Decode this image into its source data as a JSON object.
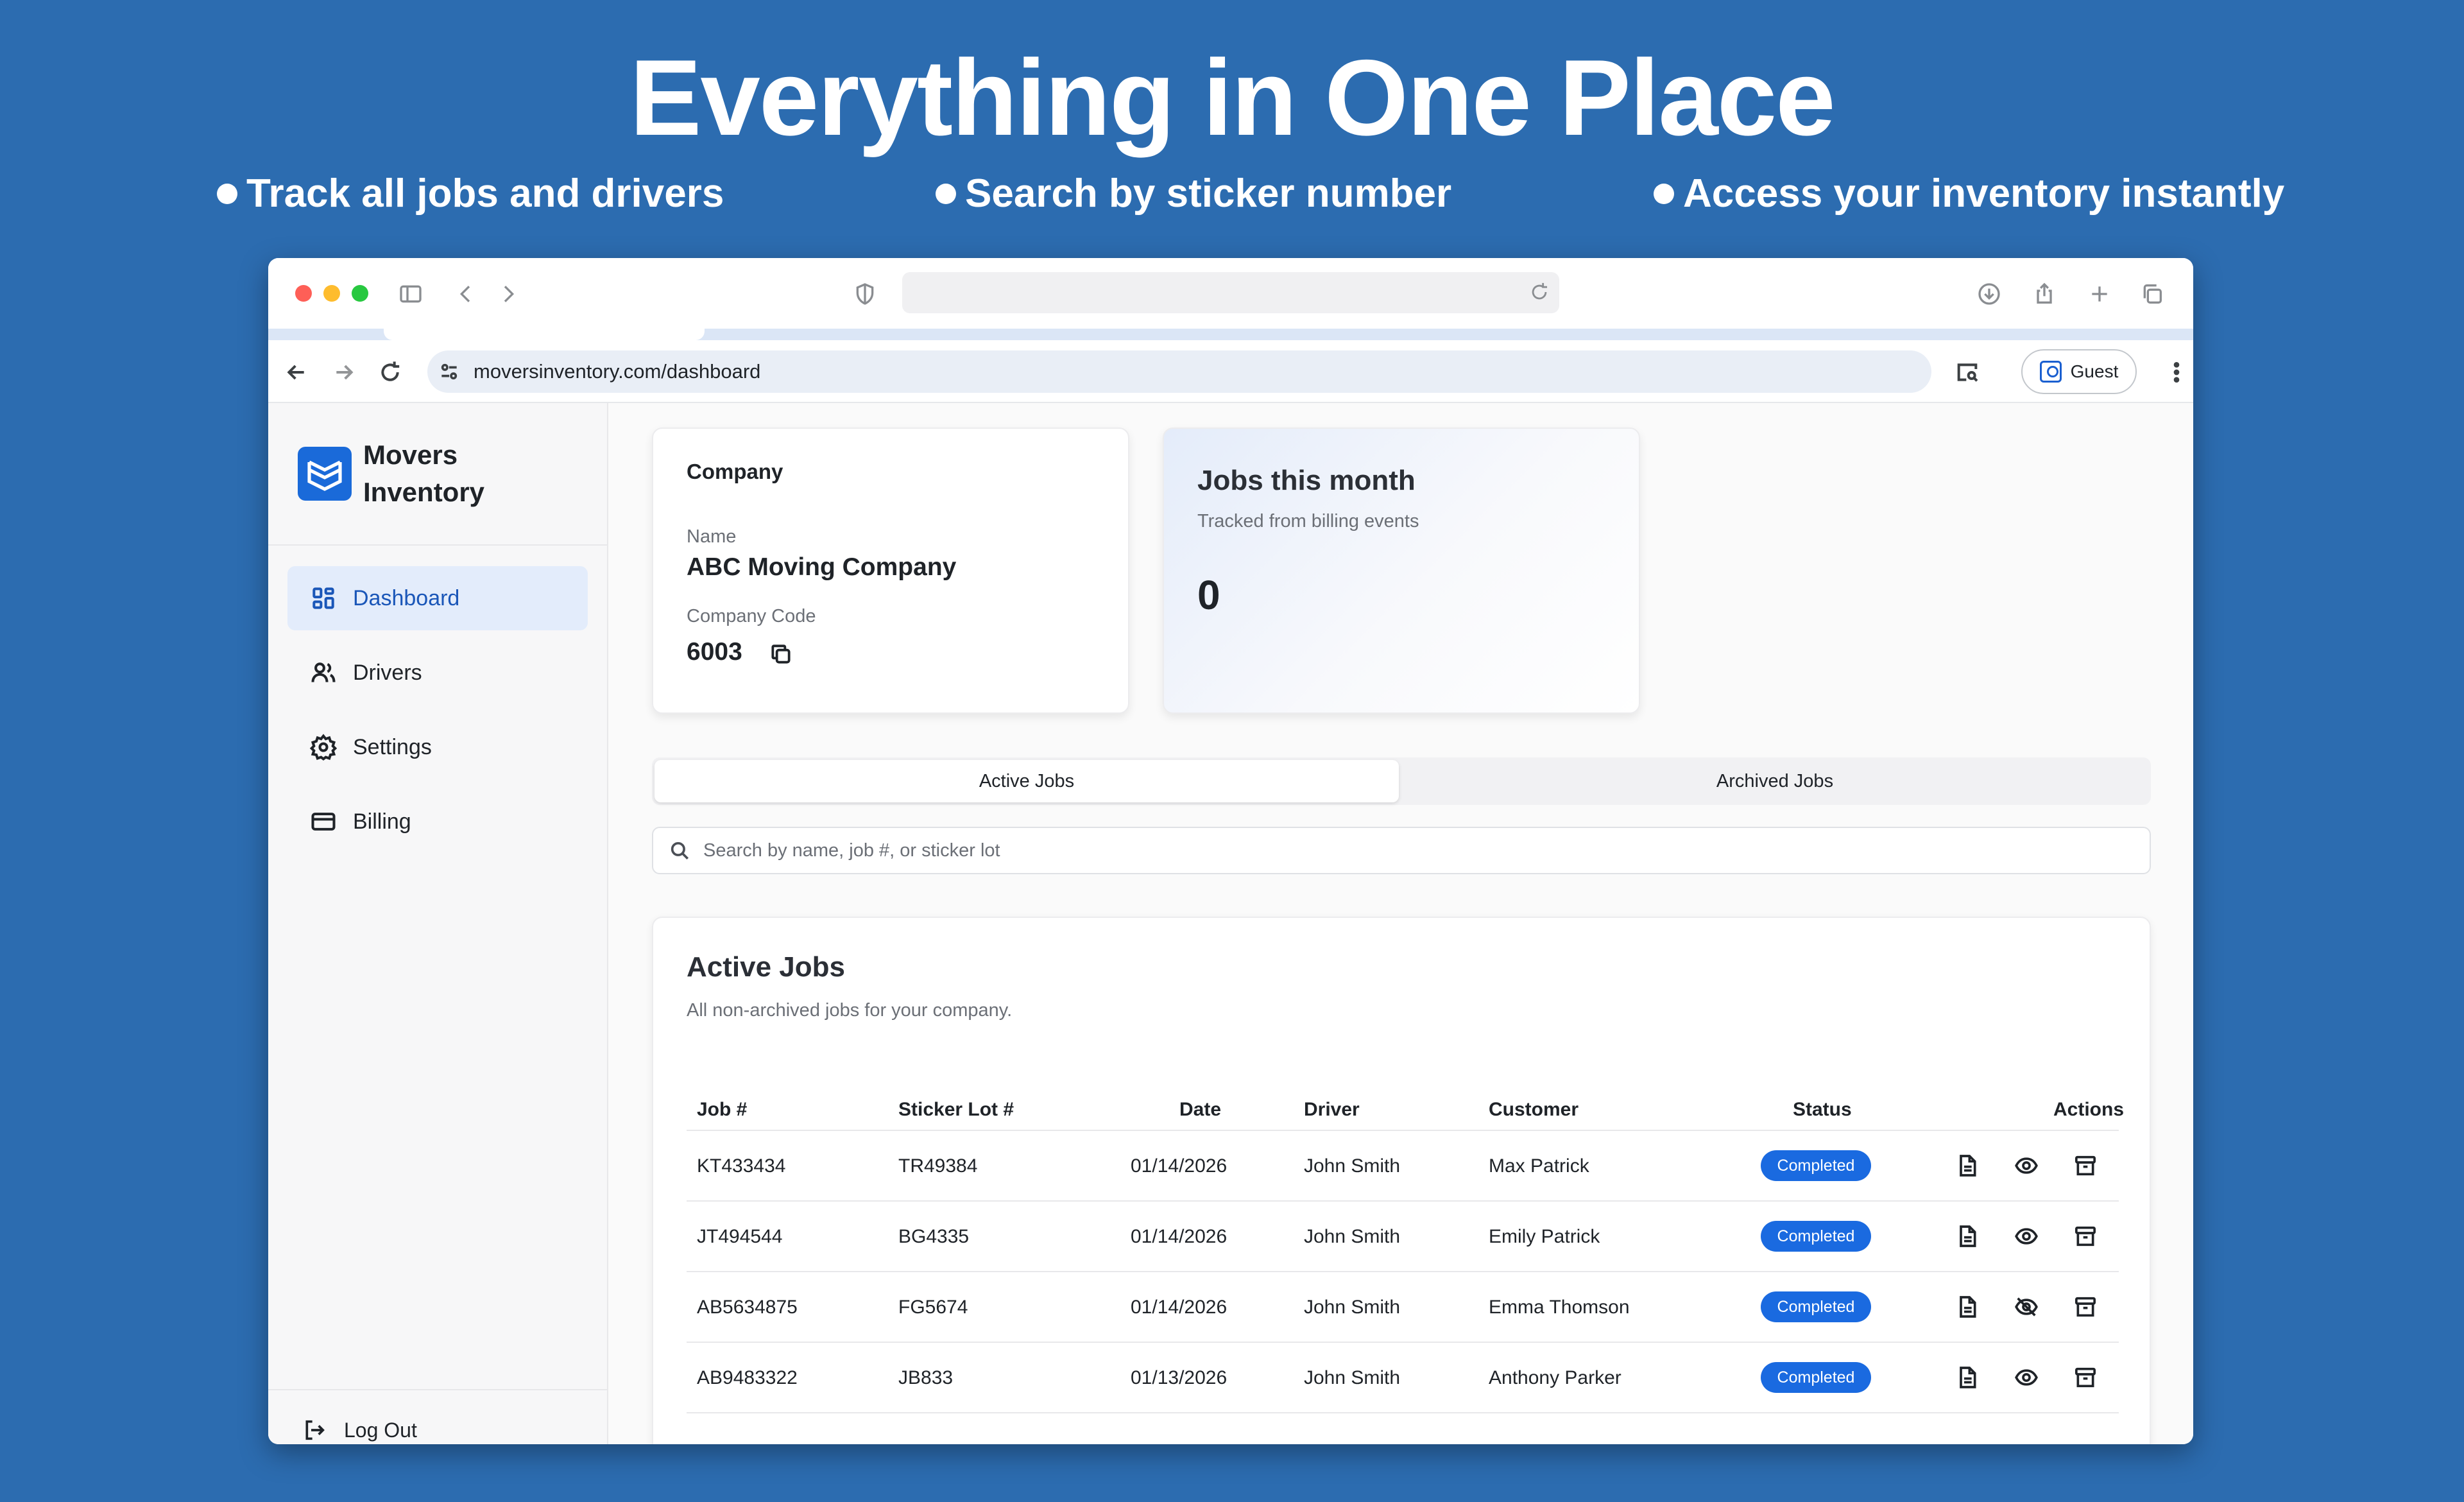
{
  "hero": {
    "title": "Everything in One Place",
    "bullets": [
      "Track all jobs and drivers",
      "Search by sticker number",
      "Access your inventory instantly"
    ]
  },
  "browser": {
    "url": "moversinventory.com/dashboard",
    "profile_label": "Guest"
  },
  "brand": {
    "line1": "Movers",
    "line2": "Inventory",
    "color": "#1a6ad9"
  },
  "sidebar": {
    "items": [
      {
        "label": "Dashboard",
        "icon": "dashboard-grid-icon",
        "active": true
      },
      {
        "label": "Drivers",
        "icon": "users-icon",
        "active": false
      },
      {
        "label": "Settings",
        "icon": "gear-icon",
        "active": false
      },
      {
        "label": "Billing",
        "icon": "credit-card-icon",
        "active": false
      }
    ],
    "logout_label": "Log Out"
  },
  "company": {
    "title": "Company",
    "name_label": "Name",
    "name": "ABC Moving Company",
    "code_label": "Company Code",
    "code": "6003"
  },
  "jobs_month": {
    "title": "Jobs this month",
    "subtitle": "Tracked from billing events",
    "value": "0"
  },
  "tabs": {
    "active": "Active Jobs",
    "archived": "Archived Jobs"
  },
  "search": {
    "placeholder": "Search by name, job #, or sticker lot"
  },
  "table": {
    "title": "Active Jobs",
    "subtitle": "All non-archived jobs for your company.",
    "columns": [
      "Job #",
      "Sticker Lot #",
      "Date",
      "Driver",
      "Customer",
      "Status",
      "Actions"
    ],
    "rows": [
      {
        "job": "KT433434",
        "sticker": "TR49384",
        "date": "01/14/2026",
        "driver": "John Smith",
        "customer": "Max Patrick",
        "status": "Completed",
        "visible": true
      },
      {
        "job": "JT494544",
        "sticker": "BG4335",
        "date": "01/14/2026",
        "driver": "John Smith",
        "customer": "Emily Patrick",
        "status": "Completed",
        "visible": true
      },
      {
        "job": "AB5634875",
        "sticker": "FG5674",
        "date": "01/14/2026",
        "driver": "John Smith",
        "customer": "Emma Thomson",
        "status": "Completed",
        "visible": false
      },
      {
        "job": "AB9483322",
        "sticker": "JB833",
        "date": "01/13/2026",
        "driver": "John Smith",
        "customer": "Anthony Parker",
        "status": "Completed",
        "visible": true
      }
    ]
  },
  "colors": {
    "background": "#2c6cb0",
    "accent": "#1a6ae0",
    "active_nav_bg": "#e3ecfb"
  }
}
